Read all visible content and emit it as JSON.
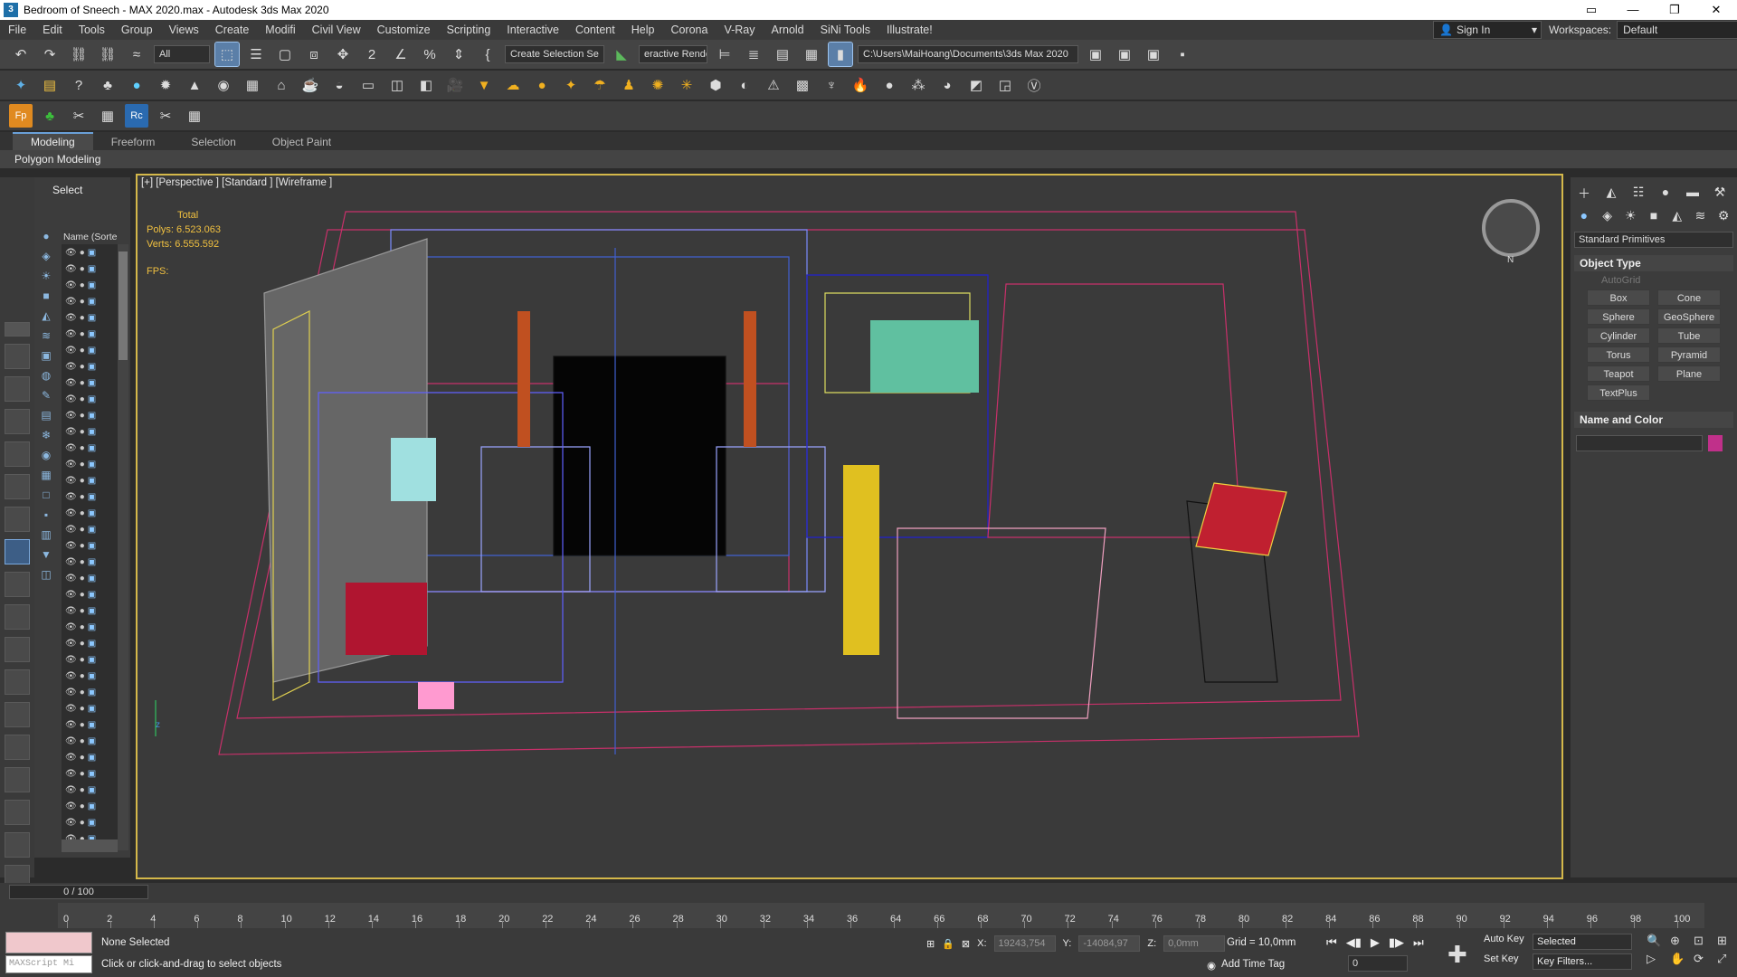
{
  "window": {
    "title": "Bedroom of Sneech - MAX 2020.max - Autodesk 3ds Max 2020",
    "app_icon": "3"
  },
  "menu": [
    "File",
    "Edit",
    "Tools",
    "Group",
    "Views",
    "Create",
    "Modifi",
    "Civil View",
    "Customize",
    "Scripting",
    "Interactive",
    "Content",
    "Help",
    "Corona",
    "V-Ray",
    "Arnold",
    "SiNi Tools",
    "Illustrate!"
  ],
  "account": {
    "sign_in": "Sign In",
    "workspaces_label": "Workspaces:",
    "workspace": "Default"
  },
  "toolbar": {
    "filter": "All",
    "selection_set": "Create Selection Se",
    "interactive_render": "eractive Rende",
    "project_path": "C:\\Users\\MaiHoang\\Documents\\3ds Max 2020"
  },
  "ribbon": {
    "tabs": [
      "Modeling",
      "Freeform",
      "Selection",
      "Object Paint"
    ],
    "active": "Modeling",
    "panel": "Polygon Modeling"
  },
  "scene_explorer": {
    "header": "Select",
    "column": "Name (Sorted A"
  },
  "viewport": {
    "label": "[+] [Perspective ] [Standard ] [Wireframe ]",
    "stats": {
      "total": "Total",
      "polys_label": "Polys:",
      "polys": "6.523.063",
      "verts_label": "Verts:",
      "verts": "6.555.592",
      "fps_label": "FPS:"
    },
    "viewcube_label": "N",
    "axis_z": "z"
  },
  "command_panel": {
    "category": "Standard Primitives",
    "object_type_title": "Object Type",
    "autogrid": "AutoGrid",
    "buttons": [
      "Box",
      "Cone",
      "Sphere",
      "GeoSphere",
      "Cylinder",
      "Tube",
      "Torus",
      "Pyramid",
      "Teapot",
      "Plane",
      "TextPlus"
    ],
    "name_color_title": "Name and Color",
    "color": "#c0308a"
  },
  "timeline": {
    "slider": "0 / 100",
    "ticks": [
      "0",
      "2",
      "4",
      "6",
      "8",
      "10",
      "12",
      "14",
      "16",
      "18",
      "20",
      "22",
      "24",
      "26",
      "28",
      "30",
      "32",
      "34",
      "36",
      "64",
      "66",
      "68",
      "70",
      "72",
      "74",
      "76",
      "78",
      "80",
      "82",
      "84",
      "86",
      "88",
      "90",
      "92",
      "94",
      "96",
      "98",
      "100"
    ]
  },
  "status": {
    "selection": "None Selected",
    "hint": "Click or click-and-drag to select objects",
    "maxscript": "MAXScript Mi",
    "x_label": "X:",
    "x": "19243,754",
    "y_label": "Y:",
    "y": "-14084,97",
    "z_label": "Z:",
    "z": "0,0mm",
    "grid": "Grid = 10,0mm",
    "add_time_tag": "Add Time Tag",
    "frame": "0",
    "auto_key": "Auto Key",
    "auto_key_value": "Selected",
    "set_key": "Set Key",
    "key_filters": "Key Filters..."
  }
}
